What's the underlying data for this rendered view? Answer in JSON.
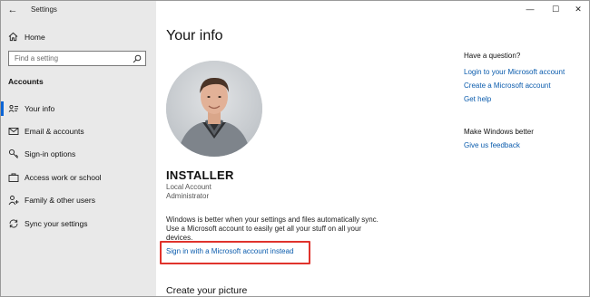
{
  "window": {
    "app_title": "Settings",
    "controls": {
      "minimize": "—",
      "maximize": "☐",
      "close": "✕"
    },
    "back_glyph": "←"
  },
  "sidebar": {
    "home_label": "Home",
    "search_placeholder": "Find a setting",
    "section_title": "Accounts",
    "items": [
      {
        "label": "Your info",
        "icon": "person-card-icon",
        "active": true
      },
      {
        "label": "Email & accounts",
        "icon": "mail-icon",
        "active": false
      },
      {
        "label": "Sign-in options",
        "icon": "key-icon",
        "active": false
      },
      {
        "label": "Access work or school",
        "icon": "briefcase-icon",
        "active": false
      },
      {
        "label": "Family & other users",
        "icon": "person-plus-icon",
        "active": false
      },
      {
        "label": "Sync your settings",
        "icon": "sync-icon",
        "active": false
      }
    ]
  },
  "main": {
    "title": "Your info",
    "user_name": "INSTALLER",
    "account_type": "Local Account",
    "account_role": "Administrator",
    "info_text": "Windows is better when your settings and files automatically sync. Use a Microsoft account to easily get all your stuff on all your devices.",
    "sign_in_link": "Sign in with a Microsoft account instead",
    "create_picture_heading": "Create your picture"
  },
  "right_column": {
    "question_heading": "Have a question?",
    "question_links": [
      "Login to your Microsoft account",
      "Create a Microsoft account",
      "Get help"
    ],
    "feedback_heading": "Make Windows better",
    "feedback_link": "Give us feedback"
  },
  "colors": {
    "accent": "#0a64d6",
    "link": "#0b5cad",
    "highlight": "#e0332c",
    "sidebar_bg": "#e9e9e9"
  }
}
